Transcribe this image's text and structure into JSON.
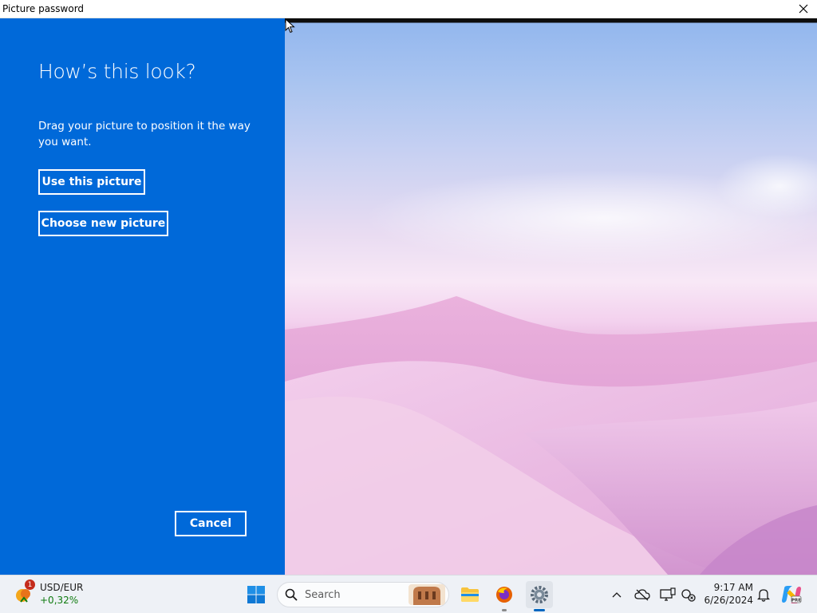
{
  "window": {
    "title": "Picture password"
  },
  "panel": {
    "heading": "How’s this look?",
    "description": "Drag your picture to position it the way you want.",
    "use_button": "Use this picture",
    "choose_button": "Choose new picture",
    "cancel_button": "Cancel",
    "background_color": "#0069d9"
  },
  "taskbar": {
    "widget": {
      "name": "USD/EUR",
      "change": "+0,32%",
      "badge": "1",
      "change_color": "#0f7b0f"
    },
    "search": {
      "placeholder": "Search"
    },
    "pinned": [
      "start-icon",
      "file-explorer-icon",
      "firefox-icon",
      "settings-icon"
    ],
    "clock": {
      "time": "9:17 AM",
      "date": "6/26/2024"
    }
  }
}
